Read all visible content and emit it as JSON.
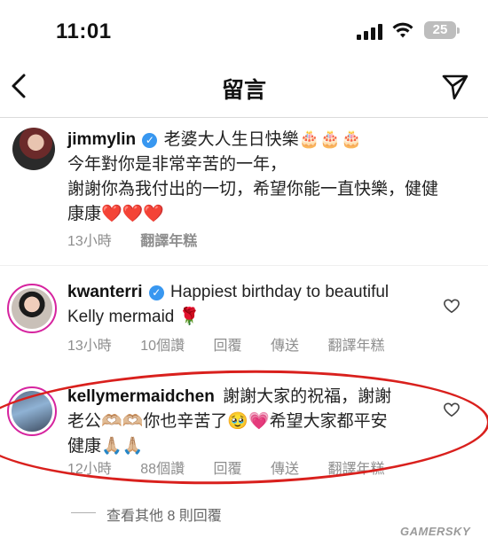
{
  "status_bar": {
    "time": "11:01",
    "battery": "25"
  },
  "header": {
    "title": "留言"
  },
  "comments": [
    {
      "username": "jimmylin",
      "lines": [
        "老婆大人生日快樂🎂🎂🎂",
        "今年對你是非常辛苦的一年，",
        "謝謝你為我付出的一切，希望你能一直快樂，健健",
        "康康❤️❤️❤️"
      ],
      "time": "13小時",
      "translate": "翻譯年糕"
    },
    {
      "username": "kwanterri",
      "lines": [
        "Happiest birthday to beautiful",
        "Kelly mermaid 🌹"
      ],
      "time": "13小時",
      "likes": "10個讚",
      "reply": "回覆",
      "send": "傳送",
      "translate": "翻譯年糕"
    },
    {
      "username": "kellymermaidchen",
      "lines": [
        "謝謝大家的祝福，謝謝",
        "老公🫶🏼🫶🏼你也辛苦了🥹💗希望大家都平安",
        "健康🙏🏼🙏🏼"
      ],
      "time": "12小時",
      "likes": "88個讚",
      "reply": "回覆",
      "send": "傳送",
      "translate": "翻譯年糕"
    }
  ],
  "more_replies": "查看其他 8 則回覆",
  "watermark": "GAMERSKY"
}
